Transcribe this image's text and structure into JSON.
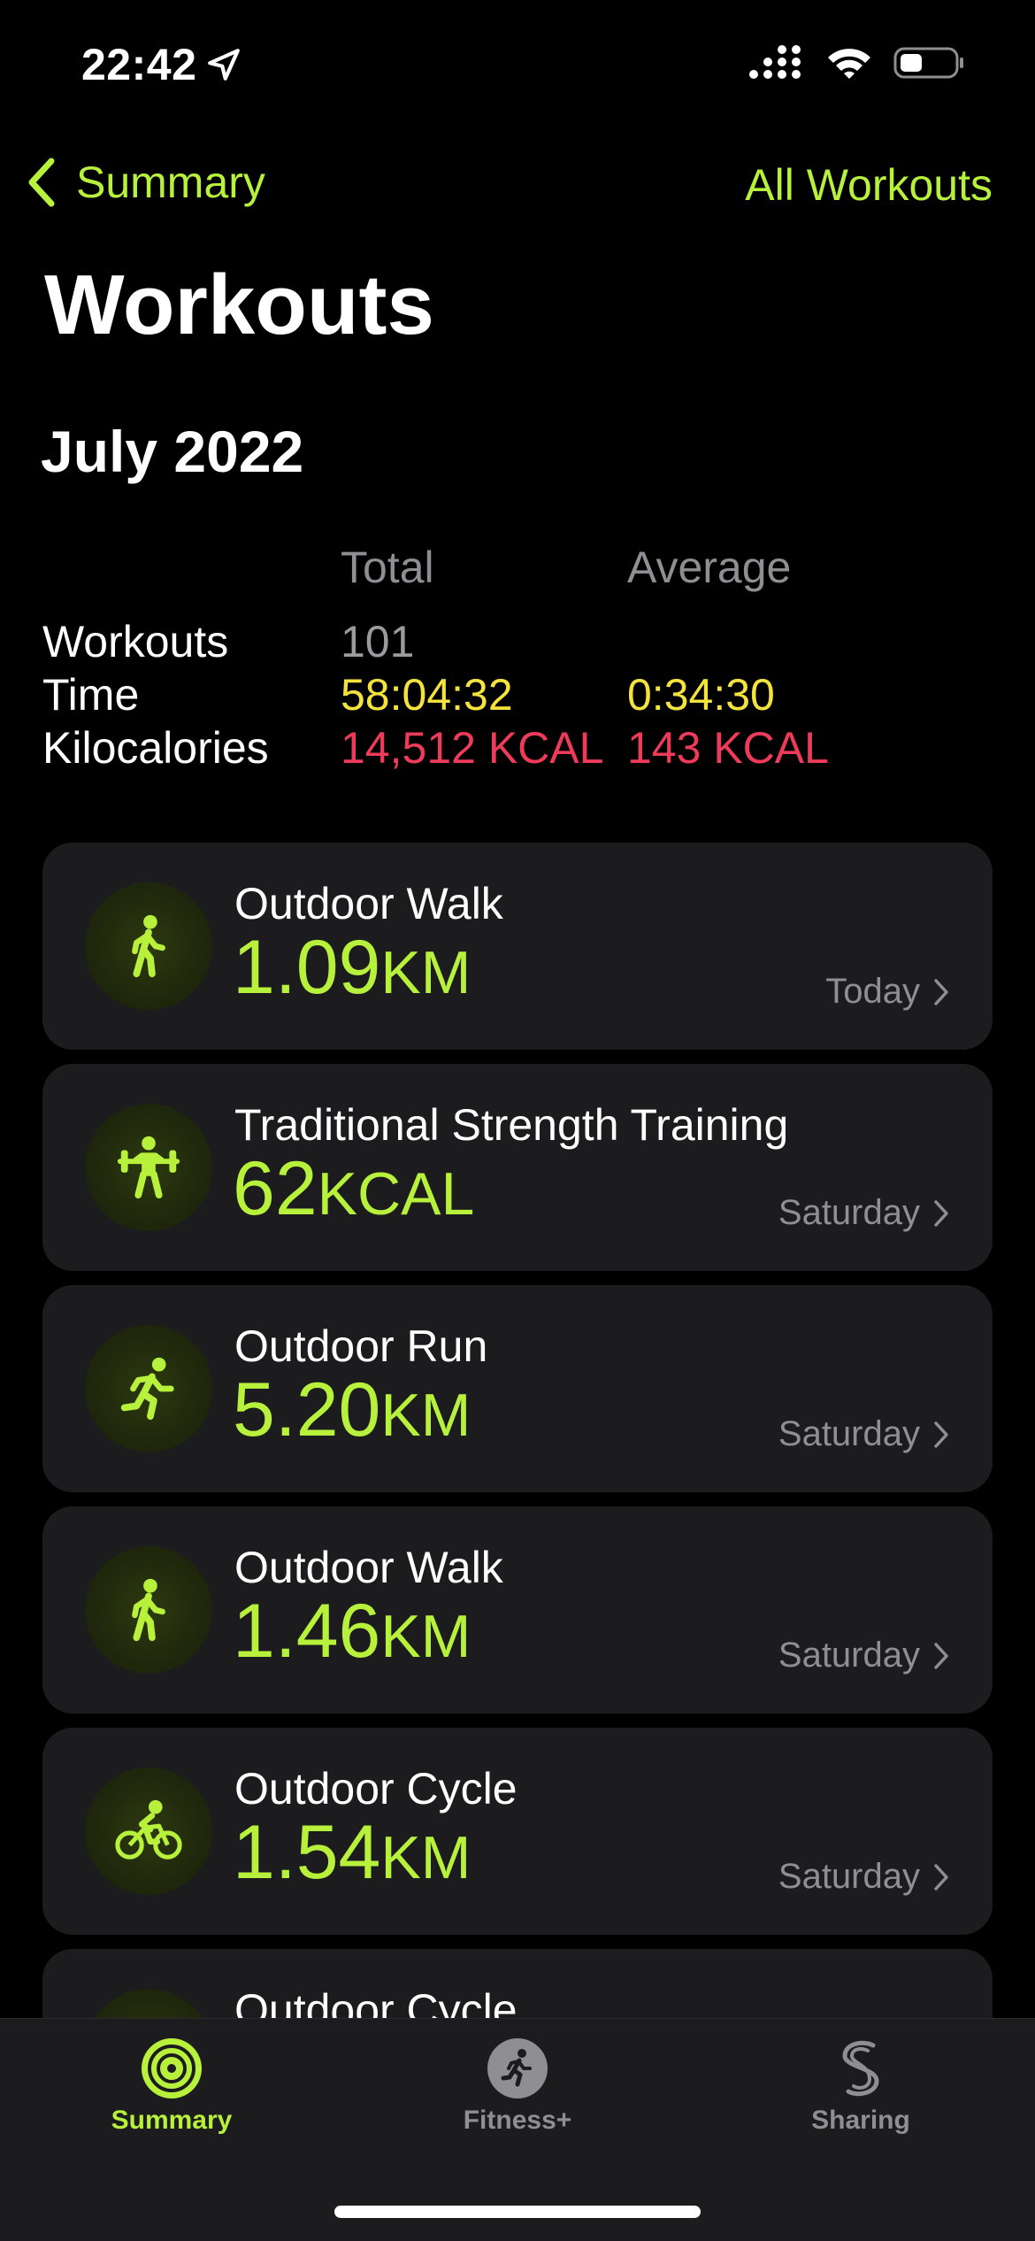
{
  "status": {
    "time": "22:42"
  },
  "nav": {
    "back_label": "Summary",
    "right_label": "All Workouts"
  },
  "title": "Workouts",
  "month": "July 2022",
  "stats": {
    "headers": {
      "total": "Total",
      "average": "Average"
    },
    "rows": [
      {
        "label": "Workouts",
        "total": "101",
        "average": ""
      },
      {
        "label": "Time",
        "total": "58:04:32",
        "average": "0:34:30"
      },
      {
        "label": "Kilocalories",
        "total": "14,512 KCAL",
        "average": "143 KCAL"
      }
    ]
  },
  "workouts": [
    {
      "name": "Outdoor Walk",
      "value": "1.09",
      "unit": "KM",
      "date": "Today",
      "icon": "walk-icon"
    },
    {
      "name": "Traditional Strength Training",
      "value": "62",
      "unit": "KCAL",
      "date": "Saturday",
      "icon": "strength-icon"
    },
    {
      "name": "Outdoor Run",
      "value": "5.20",
      "unit": "KM",
      "date": "Saturday",
      "icon": "run-icon"
    },
    {
      "name": "Outdoor Walk",
      "value": "1.46",
      "unit": "KM",
      "date": "Saturday",
      "icon": "walk-icon"
    },
    {
      "name": "Outdoor Cycle",
      "value": "1.54",
      "unit": "KM",
      "date": "Saturday",
      "icon": "cycle-icon"
    },
    {
      "name": "Outdoor Cycle",
      "value": "",
      "unit": "",
      "date": "",
      "icon": "cycle-icon"
    }
  ],
  "tabs": [
    {
      "label": "Summary",
      "active": true
    },
    {
      "label": "Fitness+",
      "active": false
    },
    {
      "label": "Sharing",
      "active": false
    }
  ],
  "colors": {
    "accent": "#b8f13c",
    "yellow": "#f3e33c",
    "red": "#ee3b5a",
    "card": "#1c1c1e",
    "muted": "#8e8e93"
  }
}
